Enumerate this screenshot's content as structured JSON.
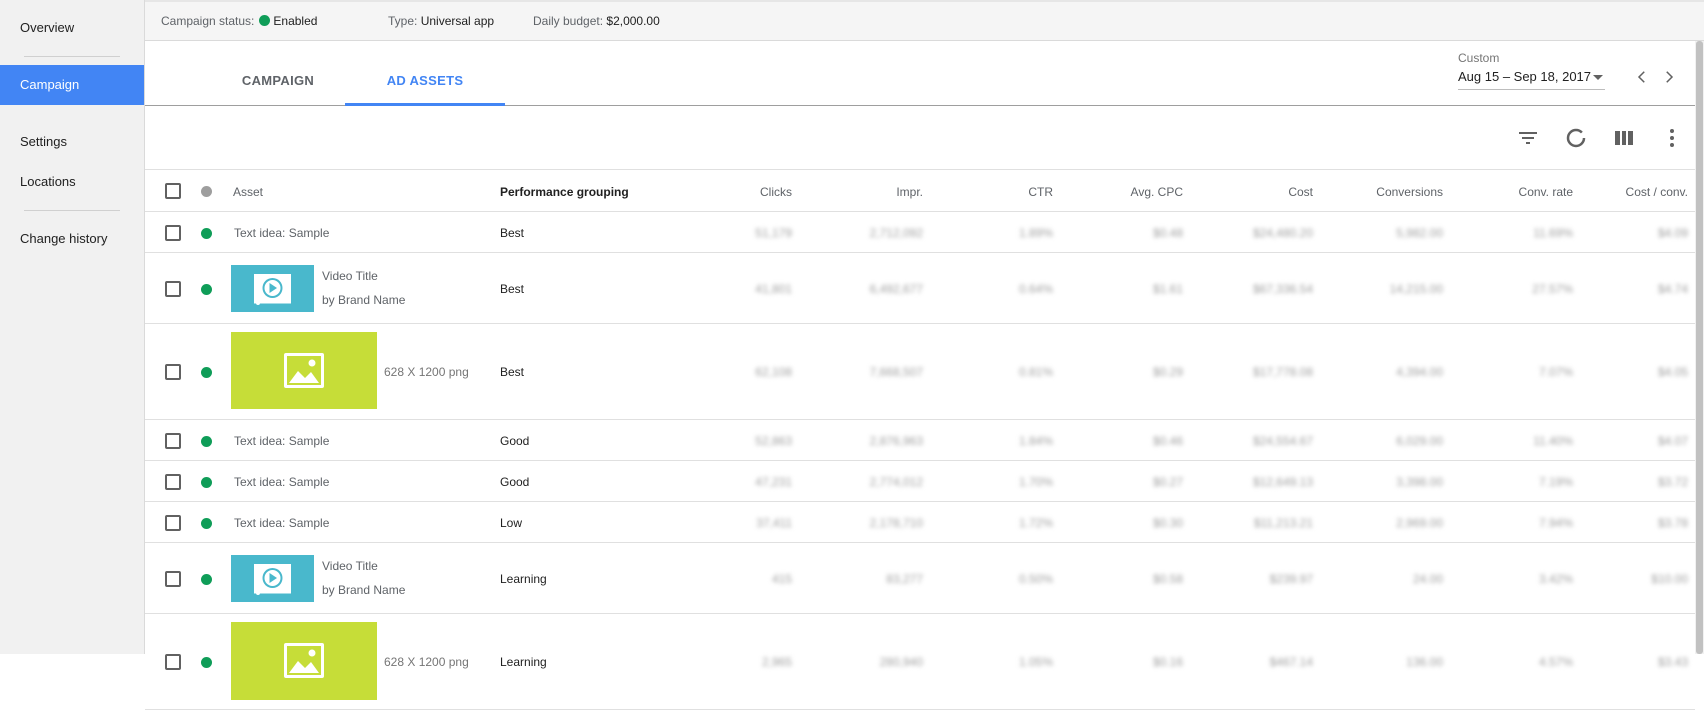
{
  "sidebar": {
    "items": [
      {
        "label": "Overview"
      },
      {
        "label": "Campaign"
      },
      {
        "label": "Settings"
      },
      {
        "label": "Locations"
      },
      {
        "label": "Change history"
      }
    ]
  },
  "status": {
    "campaign_status_label": "Campaign status:",
    "campaign_status_value": "Enabled",
    "type_label": "Type:",
    "type_value": "Universal app",
    "budget_label": "Daily budget:",
    "budget_value": "$2,000.00"
  },
  "tabs": [
    {
      "label": "CAMPAIGN"
    },
    {
      "label": "AD ASSETS"
    }
  ],
  "date_range": {
    "label": "Custom",
    "value": "Aug 15 – Sep 18, 2017"
  },
  "toolbar": {
    "icons": [
      "filter-icon",
      "segment-icon",
      "columns-icon",
      "more-vert-icon"
    ]
  },
  "table": {
    "columns": {
      "asset": "Asset",
      "performance": "Performance grouping",
      "clicks": "Clicks",
      "impr": "Impr.",
      "ctr": "CTR",
      "avg_cpc": "Avg. CPC",
      "cost": "Cost",
      "conversions": "Conversions",
      "conv_rate": "Conv. rate",
      "cost_conv": "Cost / conv."
    },
    "rows": [
      {
        "type": "text",
        "asset": "Text idea: Sample",
        "performance": "Best",
        "clicks": "51,179",
        "impr": "2,712,092",
        "ctr": "1.89%",
        "avg_cpc": "$0.48",
        "cost": "$24,480.20",
        "conversions": "5,982.00",
        "conv_rate": "11.69%",
        "cost_conv": "$4.09"
      },
      {
        "type": "video",
        "title": "Video Title",
        "subtitle": "by Brand Name",
        "performance": "Best",
        "clicks": "41,801",
        "impr": "6,492,677",
        "ctr": "0.64%",
        "avg_cpc": "$1.61",
        "cost": "$67,336.54",
        "conversions": "14,215.00",
        "conv_rate": "27.57%",
        "cost_conv": "$4.74"
      },
      {
        "type": "image",
        "caption": "628 X 1200 png",
        "performance": "Best",
        "clicks": "62,108",
        "impr": "7,668,507",
        "ctr": "0.81%",
        "avg_cpc": "$0.29",
        "cost": "$17,778.08",
        "conversions": "4,394.00",
        "conv_rate": "7.07%",
        "cost_conv": "$4.05"
      },
      {
        "type": "text",
        "asset": "Text idea: Sample",
        "performance": "Good",
        "clicks": "52,863",
        "impr": "2,876,963",
        "ctr": "1.84%",
        "avg_cpc": "$0.46",
        "cost": "$24,554.67",
        "conversions": "6,029.00",
        "conv_rate": "11.40%",
        "cost_conv": "$4.07"
      },
      {
        "type": "text",
        "asset": "Text idea: Sample",
        "performance": "Good",
        "clicks": "47,231",
        "impr": "2,774,012",
        "ctr": "1.70%",
        "avg_cpc": "$0.27",
        "cost": "$12,649.13",
        "conversions": "3,398.00",
        "conv_rate": "7.19%",
        "cost_conv": "$3.72"
      },
      {
        "type": "text",
        "asset": "Text idea: Sample",
        "performance": "Low",
        "clicks": "37,411",
        "impr": "2,178,710",
        "ctr": "1.72%",
        "avg_cpc": "$0.30",
        "cost": "$11,213.21",
        "conversions": "2,969.00",
        "conv_rate": "7.94%",
        "cost_conv": "$3.78"
      },
      {
        "type": "video",
        "title": "Video Title",
        "subtitle": "by Brand Name",
        "performance": "Learning",
        "clicks": "415",
        "impr": "83,277",
        "ctr": "0.50%",
        "avg_cpc": "$0.58",
        "cost": "$239.97",
        "conversions": "24.00",
        "conv_rate": "3.42%",
        "cost_conv": "$10.00"
      },
      {
        "type": "image",
        "caption": "628 X 1200 png",
        "performance": "Learning",
        "clicks": "2,965",
        "impr": "280,940",
        "ctr": "1.05%",
        "avg_cpc": "$0.16",
        "cost": "$467.14",
        "conversions": "136.00",
        "conv_rate": "4.57%",
        "cost_conv": "$3.43"
      }
    ]
  }
}
